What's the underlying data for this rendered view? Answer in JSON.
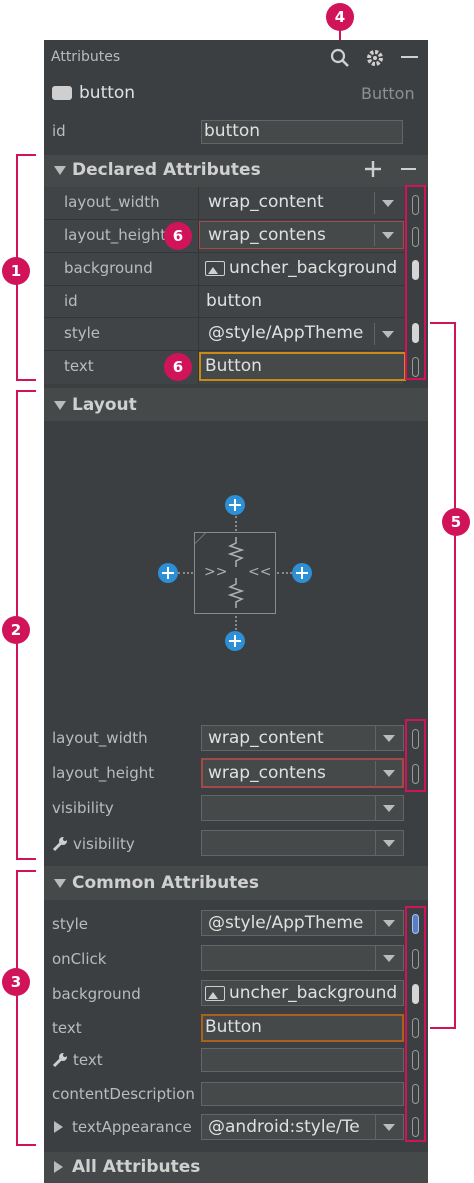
{
  "header": {
    "title": "Attributes"
  },
  "component": {
    "name": "button",
    "type": "Button"
  },
  "id_row": {
    "label": "id",
    "value": "button"
  },
  "declared": {
    "title": "Declared Attributes",
    "rows": [
      {
        "label": "layout_width",
        "value": "wrap_content"
      },
      {
        "label": "layout_height",
        "value": "wrap_contens"
      },
      {
        "label": "background",
        "value": "uncher_background"
      },
      {
        "label": "id",
        "value": "button"
      },
      {
        "label": "style",
        "value": "@style/AppTheme"
      },
      {
        "label": "text",
        "value": "Button"
      }
    ]
  },
  "layout": {
    "title": "Layout",
    "rows": [
      {
        "label": "layout_width",
        "value": "wrap_content"
      },
      {
        "label": "layout_height",
        "value": "wrap_contens"
      },
      {
        "label": "visibility",
        "value": ""
      },
      {
        "label": "visibility",
        "value": ""
      }
    ],
    "chevron_left": ">>",
    "chevron_right": "<<"
  },
  "common": {
    "title": "Common Attributes",
    "rows": [
      {
        "label": "style",
        "value": "@style/AppTheme"
      },
      {
        "label": "onClick",
        "value": ""
      },
      {
        "label": "background",
        "value": "uncher_background"
      },
      {
        "label": "text",
        "value": "Button"
      },
      {
        "label": "text",
        "value": ""
      },
      {
        "label": "contentDescription",
        "value": ""
      },
      {
        "label": "textAppearance",
        "value": "@android:style/Te"
      }
    ]
  },
  "all": {
    "title": "All Attributes"
  },
  "callouts": {
    "c1": "1",
    "c2": "2",
    "c3": "3",
    "c4": "4",
    "c5": "5",
    "c6": "6"
  },
  "colors": {
    "panel": "#3c3f41",
    "callout": "#d1145a",
    "constraint_handle": "#2d8fd5"
  }
}
